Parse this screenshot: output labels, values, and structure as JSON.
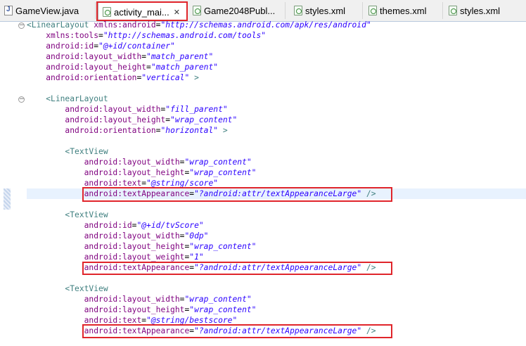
{
  "tabs": [
    {
      "label": "GameView.java",
      "icon": "java-file-icon",
      "active": false
    },
    {
      "label": "activity_mai...",
      "icon": "xml-file-icon",
      "active": true,
      "close": "✕"
    },
    {
      "label": "Game2048Publ...",
      "icon": "xml-file-icon",
      "active": false
    },
    {
      "label": "styles.xml",
      "icon": "xml-file-icon",
      "active": false
    },
    {
      "label": "themes.xml",
      "icon": "xml-file-icon",
      "active": false
    },
    {
      "label": "styles.xml",
      "icon": "xml-file-icon",
      "active": false
    }
  ],
  "code_lines": [
    [
      [
        "tag",
        "<LinearLayout "
      ],
      [
        "attr",
        "xmlns:android"
      ],
      [
        "pun",
        "="
      ],
      [
        "val",
        "\"http://schemas.android.com/apk/res/android\""
      ]
    ],
    [
      [
        "pun",
        "    "
      ],
      [
        "attr",
        "xmlns:tools"
      ],
      [
        "pun",
        "="
      ],
      [
        "val",
        "\"http://schemas.android.com/tools\""
      ]
    ],
    [
      [
        "pun",
        "    "
      ],
      [
        "attr",
        "android:id"
      ],
      [
        "pun",
        "="
      ],
      [
        "val",
        "\"@+id/container\""
      ]
    ],
    [
      [
        "pun",
        "    "
      ],
      [
        "attr",
        "android:layout_width"
      ],
      [
        "pun",
        "="
      ],
      [
        "val",
        "\"match_parent\""
      ]
    ],
    [
      [
        "pun",
        "    "
      ],
      [
        "attr",
        "android:layout_height"
      ],
      [
        "pun",
        "="
      ],
      [
        "val",
        "\"match_parent\""
      ]
    ],
    [
      [
        "pun",
        "    "
      ],
      [
        "attr",
        "android:orientation"
      ],
      [
        "pun",
        "="
      ],
      [
        "val",
        "\"vertical\""
      ],
      [
        "tag",
        " >"
      ]
    ],
    [],
    [
      [
        "pun",
        "    "
      ],
      [
        "tag",
        "<LinearLayout"
      ]
    ],
    [
      [
        "pun",
        "        "
      ],
      [
        "attr",
        "android:layout_width"
      ],
      [
        "pun",
        "="
      ],
      [
        "val",
        "\"fill_parent\""
      ]
    ],
    [
      [
        "pun",
        "        "
      ],
      [
        "attr",
        "android:layout_height"
      ],
      [
        "pun",
        "="
      ],
      [
        "val",
        "\"wrap_content\""
      ]
    ],
    [
      [
        "pun",
        "        "
      ],
      [
        "attr",
        "android:orientation"
      ],
      [
        "pun",
        "="
      ],
      [
        "val",
        "\"horizontal\""
      ],
      [
        "tag",
        " >"
      ]
    ],
    [],
    [
      [
        "pun",
        "        "
      ],
      [
        "tag",
        "<TextView"
      ]
    ],
    [
      [
        "pun",
        "            "
      ],
      [
        "attr",
        "android:layout_width"
      ],
      [
        "pun",
        "="
      ],
      [
        "val",
        "\"wrap_content\""
      ]
    ],
    [
      [
        "pun",
        "            "
      ],
      [
        "attr",
        "android:layout_height"
      ],
      [
        "pun",
        "="
      ],
      [
        "val",
        "\"wrap_content\""
      ]
    ],
    [
      [
        "pun",
        "            "
      ],
      [
        "attr",
        "android:text"
      ],
      [
        "pun",
        "="
      ],
      [
        "val",
        "\"@string/score\""
      ]
    ],
    [
      [
        "pun",
        "            "
      ],
      [
        "attr",
        "android:textAppearance"
      ],
      [
        "pun",
        "="
      ],
      [
        "val",
        "\"?android:attr/textAppearanceLarge\""
      ],
      [
        "tag",
        " />"
      ]
    ],
    [],
    [
      [
        "pun",
        "        "
      ],
      [
        "tag",
        "<TextView"
      ]
    ],
    [
      [
        "pun",
        "            "
      ],
      [
        "attr",
        "android:id"
      ],
      [
        "pun",
        "="
      ],
      [
        "val",
        "\"@+id/tvScore\""
      ]
    ],
    [
      [
        "pun",
        "            "
      ],
      [
        "attr",
        "android:layout_width"
      ],
      [
        "pun",
        "="
      ],
      [
        "val",
        "\"0dp\""
      ]
    ],
    [
      [
        "pun",
        "            "
      ],
      [
        "attr",
        "android:layout_height"
      ],
      [
        "pun",
        "="
      ],
      [
        "val",
        "\"wrap_content\""
      ]
    ],
    [
      [
        "pun",
        "            "
      ],
      [
        "attr",
        "android:layout_weight"
      ],
      [
        "pun",
        "="
      ],
      [
        "val",
        "\"1\""
      ]
    ],
    [
      [
        "pun",
        "            "
      ],
      [
        "attr",
        "android:textAppearance"
      ],
      [
        "pun",
        "="
      ],
      [
        "val",
        "\"?android:attr/textAppearanceLarge\""
      ],
      [
        "tag",
        " />"
      ]
    ],
    [],
    [
      [
        "pun",
        "        "
      ],
      [
        "tag",
        "<TextView"
      ]
    ],
    [
      [
        "pun",
        "            "
      ],
      [
        "attr",
        "android:layout_width"
      ],
      [
        "pun",
        "="
      ],
      [
        "val",
        "\"wrap_content\""
      ]
    ],
    [
      [
        "pun",
        "            "
      ],
      [
        "attr",
        "android:layout_height"
      ],
      [
        "pun",
        "="
      ],
      [
        "val",
        "\"wrap_content\""
      ]
    ],
    [
      [
        "pun",
        "            "
      ],
      [
        "attr",
        "android:text"
      ],
      [
        "pun",
        "="
      ],
      [
        "val",
        "\"@string/bestscore\""
      ]
    ],
    [
      [
        "pun",
        "            "
      ],
      [
        "attr",
        "android:textAppearance"
      ],
      [
        "pun",
        "="
      ],
      [
        "val",
        "\"?android:attr/textAppearanceLarge\""
      ],
      [
        "tag",
        " />"
      ]
    ]
  ],
  "colors": {
    "tag": "#3f7f7f",
    "attribute": "#7f007f",
    "value": "#2a00ff",
    "highlight_box": "#e0252b",
    "current_line": "#e8f2fe"
  }
}
